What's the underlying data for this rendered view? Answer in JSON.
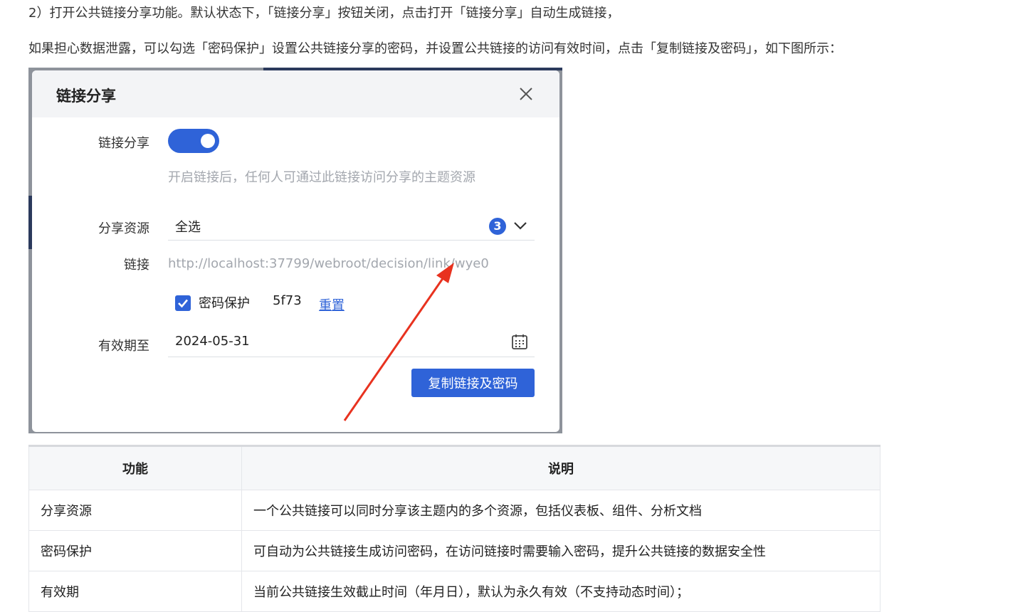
{
  "article": {
    "para1": "2）打开公共链接分享功能。默认状态下，「链接分享」按钮关闭，点击打开「链接分享」自动生成链接，",
    "para2": "如果担心数据泄露，可以勾选「密码保护」设置公共链接分享的密码，并设置公共链接的访问有效时间，点击「复制链接及密码」，如下图所示："
  },
  "dialog": {
    "title": "链接分享",
    "close_icon": "close-icon",
    "share_label": "链接分享",
    "share_enabled": true,
    "share_hint": "开启链接后，任何人可通过此链接访问分享的主题资源",
    "resource_label": "分享资源",
    "resource_value": "全选",
    "resource_count": "3",
    "link_label": "链接",
    "link_url": "http://localhost:37799/webroot/decision/link/wye0",
    "password_checked": true,
    "password_label": "密码保护",
    "password_value": "5f73",
    "reset_label": "重置",
    "expiry_label": "有效期至",
    "expiry_value": "2024-05-31",
    "copy_button": "复制链接及密码",
    "accent_color": "#2f63d8",
    "annotation_color": "#e8321f"
  },
  "table": {
    "headers": [
      "功能",
      "说明"
    ],
    "rows": [
      [
        "分享资源",
        "一个公共链接可以同时分享该主题内的多个资源，包括仪表板、组件、分析文档"
      ],
      [
        "密码保护",
        "可自动为公共链接生成访问密码，在访问链接时需要输入密码，提升公共链接的数据安全性"
      ],
      [
        "有效期",
        "当前公共链接生效截止时间（年月日），默认为永久有效（不支持动态时间）；"
      ]
    ]
  }
}
